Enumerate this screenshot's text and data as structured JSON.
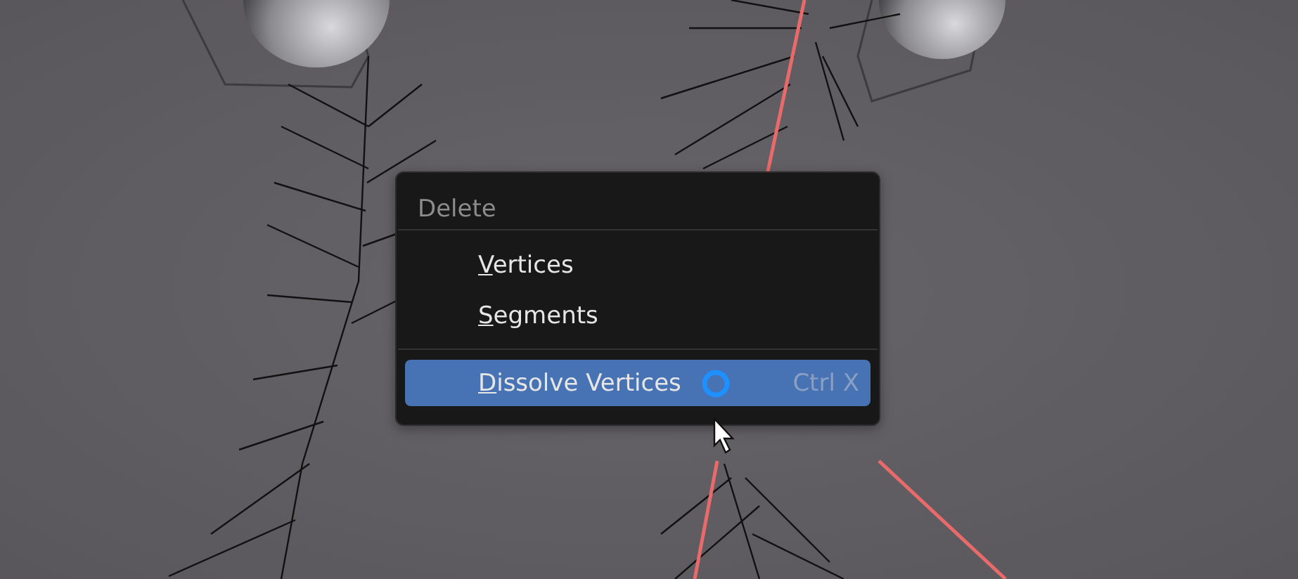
{
  "menu": {
    "title": "Delete",
    "sections": [
      {
        "items": [
          {
            "label": "Vertices",
            "selected": false
          },
          {
            "label": "Segments",
            "selected": false
          }
        ]
      },
      {
        "items": [
          {
            "label": "Dissolve Vertices",
            "selected": true,
            "shortcut": "Ctrl X"
          }
        ]
      }
    ]
  }
}
